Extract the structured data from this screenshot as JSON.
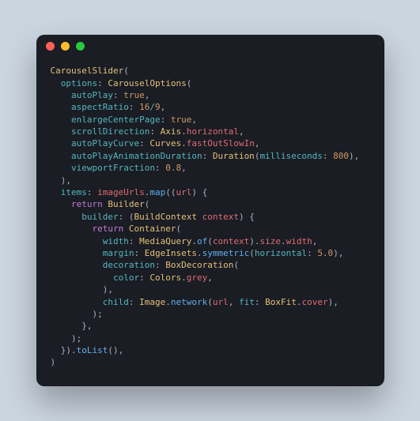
{
  "titlebar": {
    "dot_red": "red",
    "dot_yellow": "yellow",
    "dot_green": "green"
  },
  "code": {
    "t": {
      "CarouselSlider": "CarouselSlider",
      "CarouselOptions": "CarouselOptions",
      "options": "options",
      "autoPlay": "autoPlay",
      "true": "true",
      "aspectRatio": "aspectRatio",
      "n16": "16",
      "n9": "9",
      "enlargeCenterPage": "enlargeCenterPage",
      "scrollDirection": "scrollDirection",
      "Axis": "Axis",
      "horizontal": "horizontal",
      "autoPlayCurve": "autoPlayCurve",
      "Curves": "Curves",
      "fastOutSlowIn": "fastOutSlowIn",
      "autoPlayAnimationDuration": "autoPlayAnimationDuration",
      "Duration": "Duration",
      "milliseconds": "milliseconds",
      "n800": "800",
      "viewportFraction": "viewportFraction",
      "n08": "0.8",
      "items": "items",
      "imageUrls": "imageUrls",
      "map": "map",
      "url": "url",
      "return": "return",
      "Builder": "Builder",
      "builder": "builder",
      "BuildContext": "BuildContext",
      "context": "context",
      "Container": "Container",
      "width": "width",
      "MediaQuery": "MediaQuery",
      "of": "of",
      "size": "size",
      "widthProp": "width",
      "margin": "margin",
      "EdgeInsets": "EdgeInsets",
      "symmetric": "symmetric",
      "n5": "5.0",
      "decoration": "decoration",
      "BoxDecoration": "BoxDecoration",
      "color": "color",
      "Colors": "Colors",
      "grey": "grey",
      "child": "child",
      "Image": "Image",
      "network": "network",
      "fit": "fit",
      "BoxFit": "BoxFit",
      "cover": "cover",
      "toList": "toList"
    }
  },
  "chart_data": {
    "type": "table",
    "title": "Flutter CarouselSlider code snippet",
    "language": "dart",
    "widget": "CarouselSlider",
    "options": {
      "autoPlay": true,
      "aspectRatio": "16/9",
      "enlargeCenterPage": true,
      "scrollDirection": "Axis.horizontal",
      "autoPlayCurve": "Curves.fastOutSlowIn",
      "autoPlayAnimationDuration": "Duration(milliseconds: 800)",
      "viewportFraction": 0.8
    },
    "items_source": "imageUrls",
    "item_builder": {
      "wrapper": "Builder",
      "child": "Container",
      "container": {
        "width": "MediaQuery.of(context).size.width",
        "margin": "EdgeInsets.symmetric(horizontal: 5.0)",
        "decoration": {
          "color": "Colors.grey"
        },
        "child": "Image.network(url, fit: BoxFit.cover)"
      }
    }
  }
}
